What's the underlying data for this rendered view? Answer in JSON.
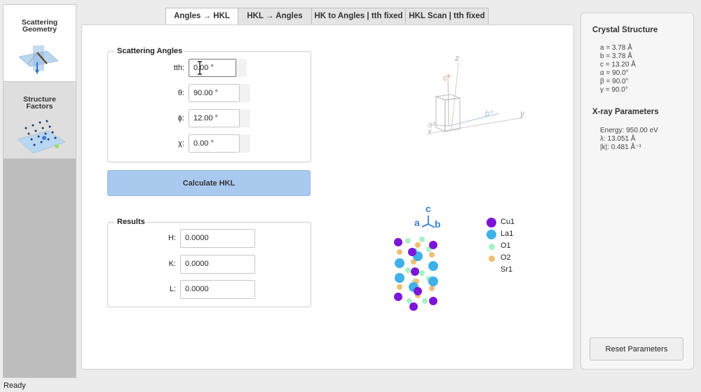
{
  "sidebar": {
    "items": [
      {
        "title": "Scattering Geometry"
      },
      {
        "title": "Structure Factors"
      }
    ]
  },
  "tabs": [
    "Angles → HKL",
    "HKL → Angles",
    "HK to Angles | tth fixed",
    "HKL Scan | tth fixed"
  ],
  "angles": {
    "title": "Scattering Angles",
    "fields": [
      {
        "label": "tth:",
        "value": "0.00 °"
      },
      {
        "label": "θ:",
        "value": "90.00 °"
      },
      {
        "label": "ϕ:",
        "value": "12.00 °"
      },
      {
        "label": "χ:",
        "value": "0.00 °"
      }
    ],
    "button": "Calculate HKL"
  },
  "results": {
    "title": "Results",
    "fields": [
      {
        "label": "H:",
        "value": "0.0000"
      },
      {
        "label": "K:",
        "value": "0.0000"
      },
      {
        "label": "L:",
        "value": "0.0000"
      }
    ]
  },
  "axes3d": {
    "z": "z",
    "c": "c*",
    "b": "b*",
    "y": "y",
    "a": "a*",
    "x": "x"
  },
  "crystal_axes": {
    "c": "c",
    "a": "a",
    "b": "b"
  },
  "legend": [
    {
      "label": "Cu1",
      "color": "#7b16d8"
    },
    {
      "label": "La1",
      "color": "#3fb0e8"
    },
    {
      "label": "O1",
      "color": "#a8f0c8"
    },
    {
      "label": "O2",
      "color": "#efbf72"
    },
    {
      "label": "Sr1",
      "color": "#ffffff"
    }
  ],
  "crystal": {
    "title": "Crystal Structure",
    "params": [
      "a = 3.78 Å",
      "b = 3.78 Å",
      "c = 13.20 Å",
      "α = 90.0°",
      "β = 90.0°",
      "γ = 90.0°"
    ]
  },
  "xray": {
    "title": "X-ray Parameters",
    "params": [
      "Energy: 950.00 eV",
      "λ: 13.051 Å",
      "|k|: 0.481 Å⁻¹"
    ]
  },
  "reset_label": "Reset Parameters",
  "status": "Ready"
}
